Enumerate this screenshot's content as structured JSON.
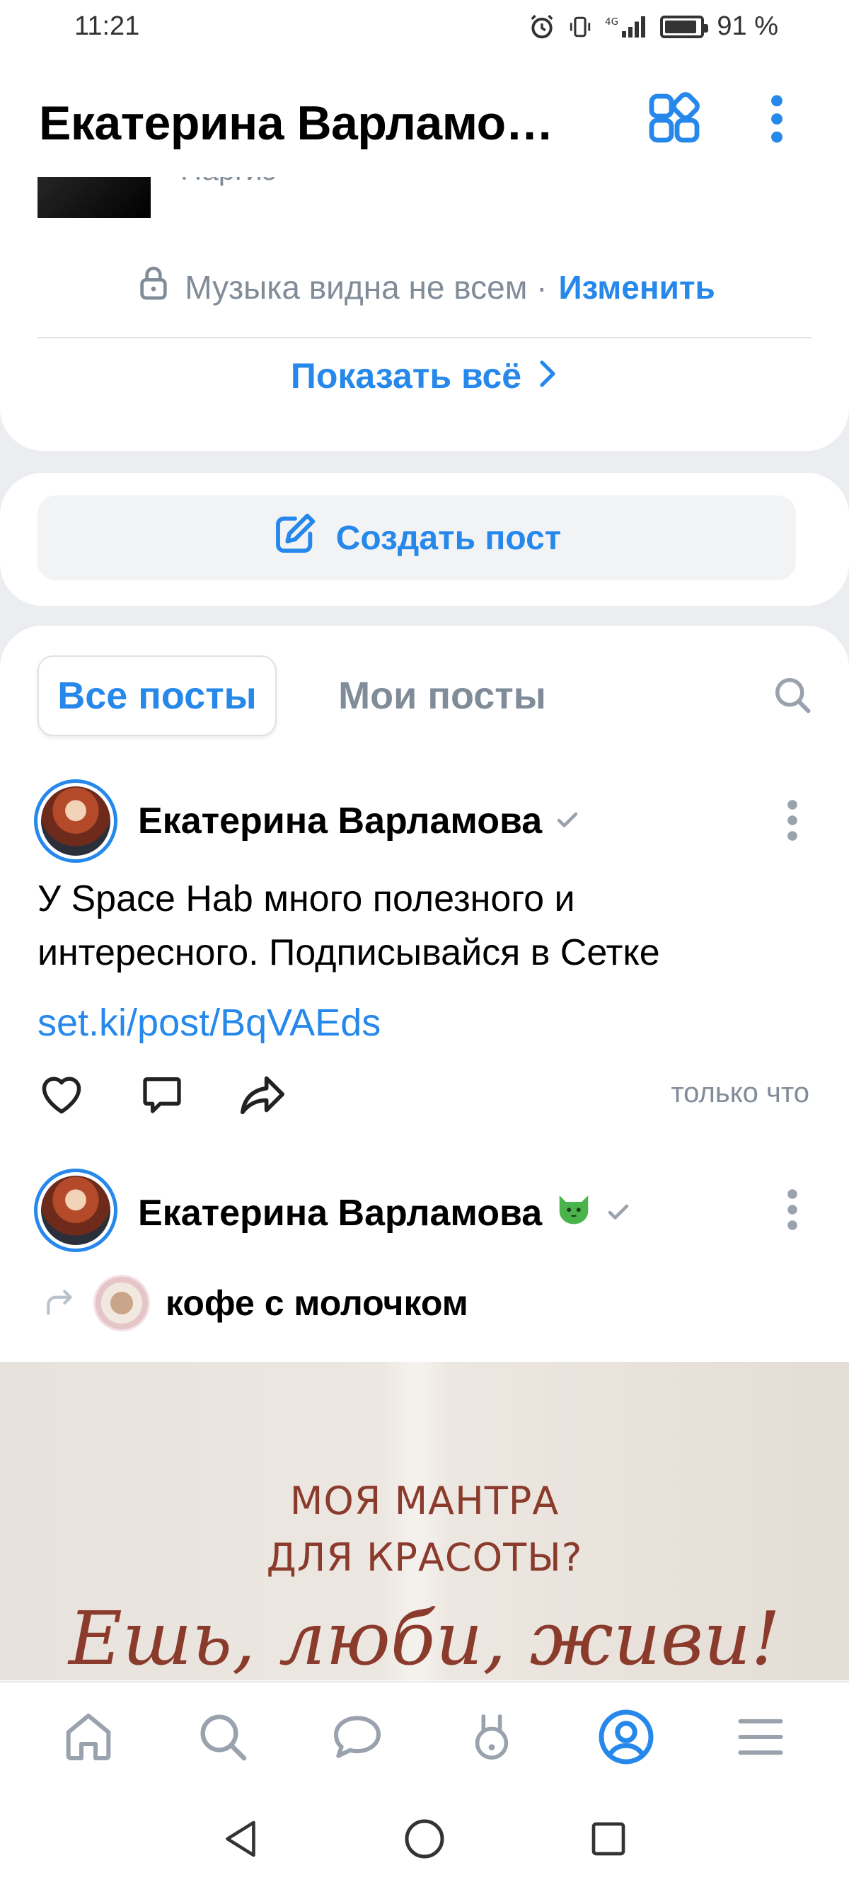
{
  "status_bar": {
    "time": "11:21",
    "network": "4G",
    "battery_percent": "91 %",
    "battery_level": 0.91
  },
  "header": {
    "title": "Екатерина Варламо…",
    "icons": [
      "grid-icon",
      "more-vertical-icon"
    ]
  },
  "music": {
    "artist": "Наргиз",
    "privacy_text": "Музыка видна не всем ·",
    "change_link": "Изменить",
    "show_all": "Показать всё"
  },
  "create_post": {
    "label": "Создать пост"
  },
  "feed": {
    "tabs": [
      {
        "label": "Все посты",
        "active": true
      },
      {
        "label": "Мои посты",
        "active": false
      }
    ],
    "posts": [
      {
        "author": "Екатерина Варламова",
        "text_line1": "У Space Hab много полезного и",
        "text_line2": "интересного. Подписывайся в Сетке",
        "link": "set.ki/post/BqVAEds",
        "time": "только что"
      },
      {
        "author": "Екатерина Варламова",
        "repost_from": "кофе с молочком",
        "image_text_line1": "МОЯ МАНТРА",
        "image_text_line2": "ДЛЯ КРАСОТЫ?",
        "image_text_line3": "Ешь, люби, живи!"
      }
    ]
  },
  "bottom_nav": {
    "items": [
      "home-icon",
      "search-icon",
      "messages-icon",
      "clips-icon",
      "profile-icon",
      "menu-icon"
    ],
    "active": "profile-icon",
    "accent": "#2688eb"
  },
  "colors": {
    "accent": "#2688eb",
    "secondary_text": "#818c99",
    "background": "#ebedf0"
  }
}
